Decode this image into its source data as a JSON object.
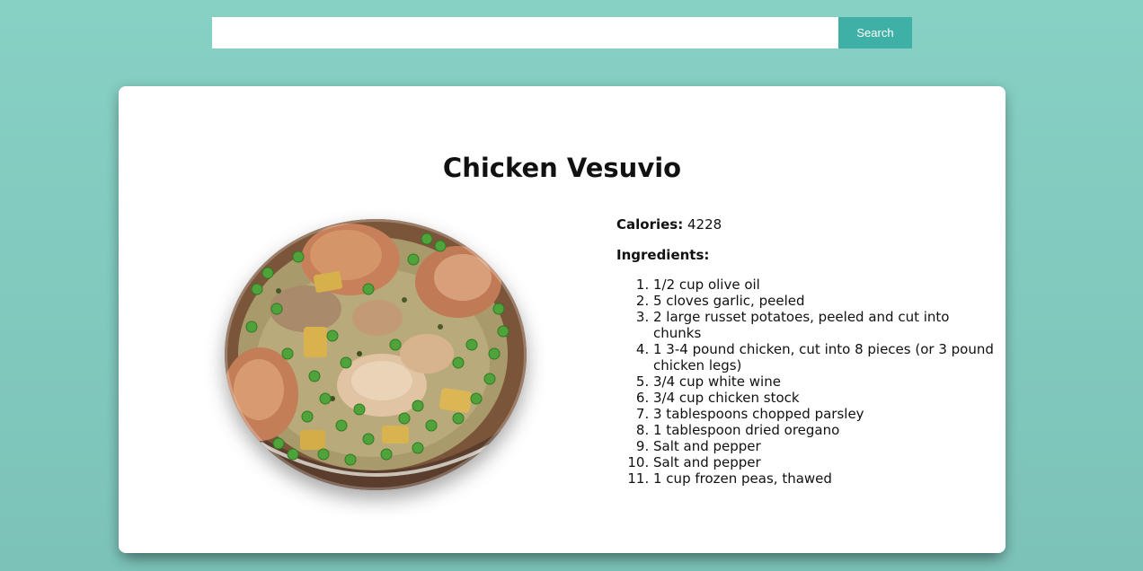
{
  "search": {
    "value": "",
    "placeholder": "",
    "button_label": "Search"
  },
  "recipe": {
    "title": "Chicken Vesuvio",
    "image_alt": "chicken-vesuvio-photo",
    "calories_label": "Calories:",
    "calories_value": "4228",
    "ingredients_label": "Ingredients:",
    "ingredients": [
      "1/2 cup olive oil",
      "5 cloves garlic, peeled",
      "2 large russet potatoes, peeled and cut into chunks",
      "1 3-4 pound chicken, cut into 8 pieces (or 3 pound chicken legs)",
      "3/4 cup white wine",
      "3/4 cup chicken stock",
      "3 tablespoons chopped parsley",
      "1 tablespoon dried oregano",
      "Salt and pepper",
      "Salt and pepper",
      "1 cup frozen peas, thawed"
    ]
  },
  "colors": {
    "background": "#87d0c4",
    "accent": "#3fb0a6",
    "card": "#ffffff"
  }
}
